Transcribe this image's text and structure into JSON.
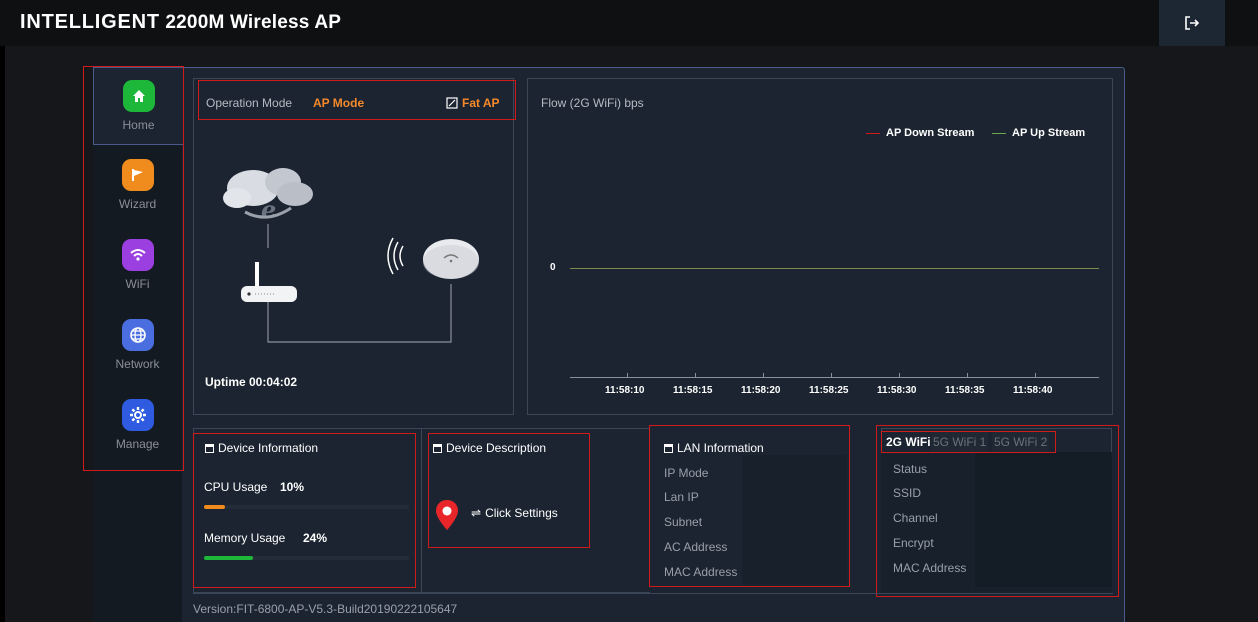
{
  "header": {
    "title_bold": "INTELLIGENT",
    "title_rest": "2200M Wireless AP",
    "logout_icon": "logout-icon"
  },
  "sidebar": {
    "items": [
      {
        "label": "Home",
        "icon": "home-icon",
        "color": "#1db83a",
        "active": true
      },
      {
        "label": "Wizard",
        "icon": "flag-icon",
        "color": "#f08c1e"
      },
      {
        "label": "WiFi",
        "icon": "wifi-icon",
        "color": "#9b3fe0"
      },
      {
        "label": "Network",
        "icon": "globe-icon",
        "color": "#4a6ee0"
      },
      {
        "label": "Manage",
        "icon": "gear-icon",
        "color": "#2e5be0"
      }
    ]
  },
  "mode": {
    "label": "Operation Mode",
    "value": "AP Mode",
    "fat_ap": "Fat AP",
    "uptime": "Uptime 00:04:02"
  },
  "flow": {
    "title": "Flow (2G WiFi) bps",
    "legend_down": "AP Down Stream",
    "legend_up": "AP Up Stream",
    "down_color": "#d11a1a",
    "up_color": "#6aa84f",
    "ticks": [
      "11:58:10",
      "11:58:15",
      "11:58:20",
      "11:58:25",
      "11:58:30",
      "11:58:35",
      "11:58:40"
    ],
    "y_label": "0"
  },
  "device_info": {
    "title": "Device Information",
    "cpu_label": "CPU Usage",
    "cpu_value": "10%",
    "cpu_fraction": 0.1,
    "mem_label": "Memory Usage",
    "mem_value": "24%",
    "mem_fraction": 0.24
  },
  "device_desc": {
    "title": "Device Description",
    "click": "Click Settings"
  },
  "lan": {
    "title": "LAN Information",
    "rows": [
      "IP Mode",
      "Lan IP",
      "Subnet",
      "AC Address",
      "MAC Address"
    ]
  },
  "wifi": {
    "tabs": [
      "2G WiFi",
      "5G WiFi 1",
      "5G WiFi 2"
    ],
    "rows": [
      "Status",
      "SSID",
      "Channel",
      "Encrypt",
      "MAC Address"
    ]
  },
  "footer": {
    "version": "Version:FIT-6800-AP-V5.3-Build20190222105647"
  }
}
